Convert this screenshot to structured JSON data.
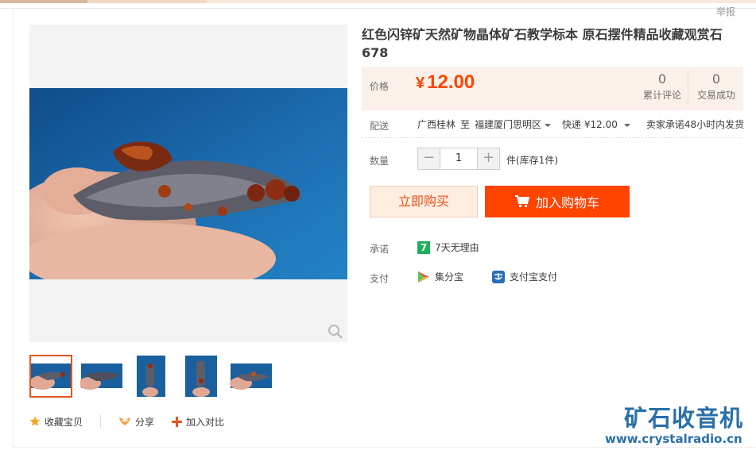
{
  "page": {
    "report_link": "举报"
  },
  "gallery": {
    "thumbnails": [
      {
        "label": "thumbnail-1",
        "active": true
      },
      {
        "label": "thumbnail-2",
        "active": false
      },
      {
        "label": "thumbnail-3",
        "active": false
      },
      {
        "label": "thumbnail-4",
        "active": false
      },
      {
        "label": "thumbnail-5",
        "active": false
      }
    ],
    "zoom_icon": "magnifier-icon"
  },
  "actions": {
    "favorite": "收藏宝贝",
    "share": "分享",
    "compare": "加入对比"
  },
  "product": {
    "title": "红色闪锌矿天然矿物晶体矿石教学标本 原石摆件精品收藏观赏石678"
  },
  "price": {
    "label": "价格",
    "currency": "¥",
    "amount": "12.00",
    "reviews_count": "0",
    "reviews_label": "累计评论",
    "sales_count": "0",
    "sales_label": "交易成功"
  },
  "shipping": {
    "label": "配送",
    "from": "广西桂林",
    "to_word": "至",
    "destination": "福建厦门思明区",
    "method": "快递 ¥12.00",
    "promise": "卖家承诺48小时内发货"
  },
  "quantity": {
    "label": "数量",
    "value": "1",
    "minus": "−",
    "plus": "+",
    "stock": "件(库存1件)"
  },
  "buttons": {
    "buy_now": "立即购买",
    "add_to_cart": "加入购物车"
  },
  "guarantee": {
    "label": "承诺",
    "badge": "7",
    "text": "7天无理由"
  },
  "payment": {
    "label": "支付",
    "methods": [
      "集分宝",
      "支付宝支付"
    ]
  },
  "watermark": {
    "logo": "矿石收音机",
    "url": "www.crystalradio.cn"
  },
  "colors": {
    "accent": "#ff4400",
    "price_bg": "#fcf1ea",
    "watermark": "#2a6fa8"
  }
}
